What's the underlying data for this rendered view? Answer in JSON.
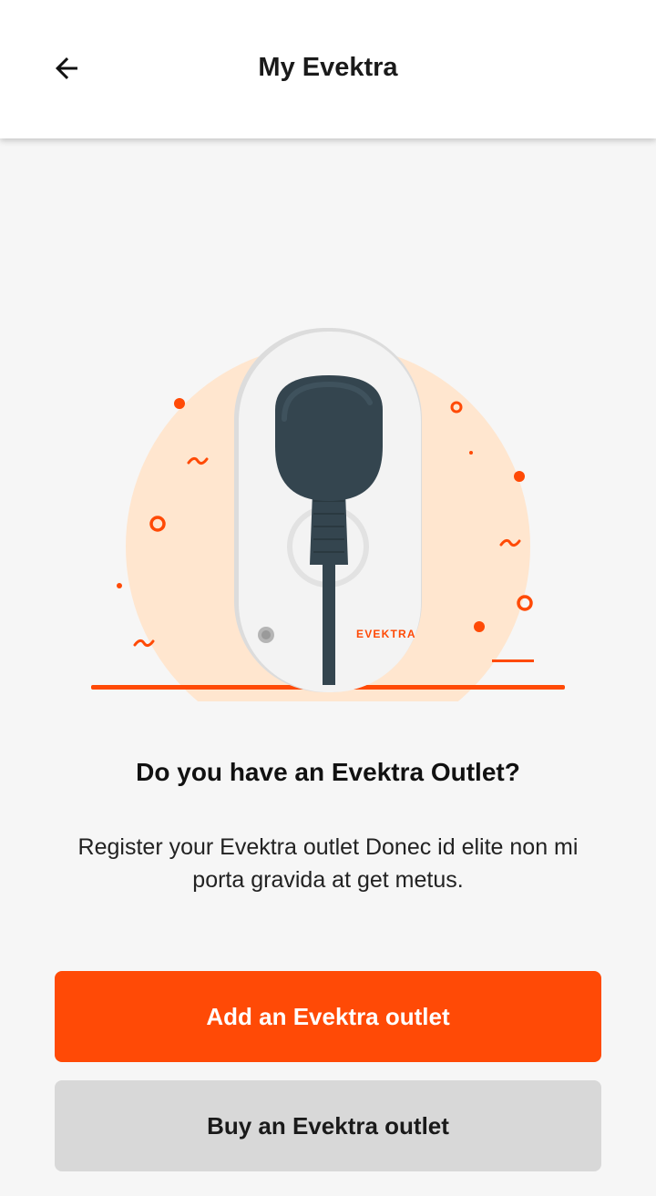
{
  "header": {
    "title": "My Evektra",
    "back_icon": "arrow-left-icon"
  },
  "illustration": {
    "brand_text": "EVEKTRA",
    "colors": {
      "accent": "#ff4a06",
      "circle": "#ffe6cf",
      "plug": "#34454f",
      "outlet": "#f3f3f3"
    }
  },
  "content": {
    "heading": "Do you have an Evektra Outlet?",
    "description": "Register your Evektra outlet Donec id elite non mi porta gravida at get metus."
  },
  "actions": {
    "primary_label": "Add an Evektra outlet",
    "secondary_label": "Buy an Evektra outlet"
  }
}
